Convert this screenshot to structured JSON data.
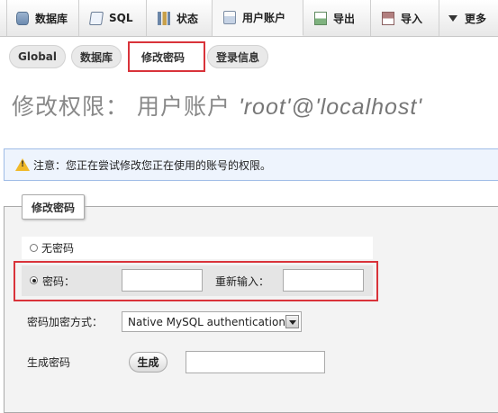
{
  "top_tabs": [
    {
      "label": "数据库",
      "icon": "database-icon"
    },
    {
      "label": "SQL",
      "icon": "sql-icon"
    },
    {
      "label": "状态",
      "icon": "status-icon"
    },
    {
      "label": "用户账户",
      "icon": "user-accounts-icon",
      "active": true
    },
    {
      "label": "导出",
      "icon": "export-icon"
    },
    {
      "label": "导入",
      "icon": "import-icon"
    },
    {
      "label": "更多",
      "icon": "chevron-down-icon"
    }
  ],
  "sub_tabs": [
    {
      "label": "Global"
    },
    {
      "label": "数据库"
    },
    {
      "label": "修改密码",
      "active": true
    },
    {
      "label": "登录信息"
    }
  ],
  "page_title": {
    "prefix": "修改权限：",
    "label": "用户账户",
    "user": "'root'@'localhost'"
  },
  "notice": "注意：您正在尝试修改您正在使用的账号的权限。",
  "change_password": {
    "legend": "修改密码",
    "no_password_label": "无密码",
    "password_label": "密码：",
    "password_selected": true,
    "retype_label": "重新输入：",
    "password_value": "",
    "retype_value": "",
    "hashing_label": "密码加密方式：",
    "hashing_selected": "Native MySQL authentication",
    "generate_label": "生成密码",
    "generate_button": "生成",
    "generated_value": ""
  },
  "colors": {
    "highlight_box": "#d9333a",
    "notice_bg": "#eef4fd",
    "notice_border": "#9fbce6"
  }
}
